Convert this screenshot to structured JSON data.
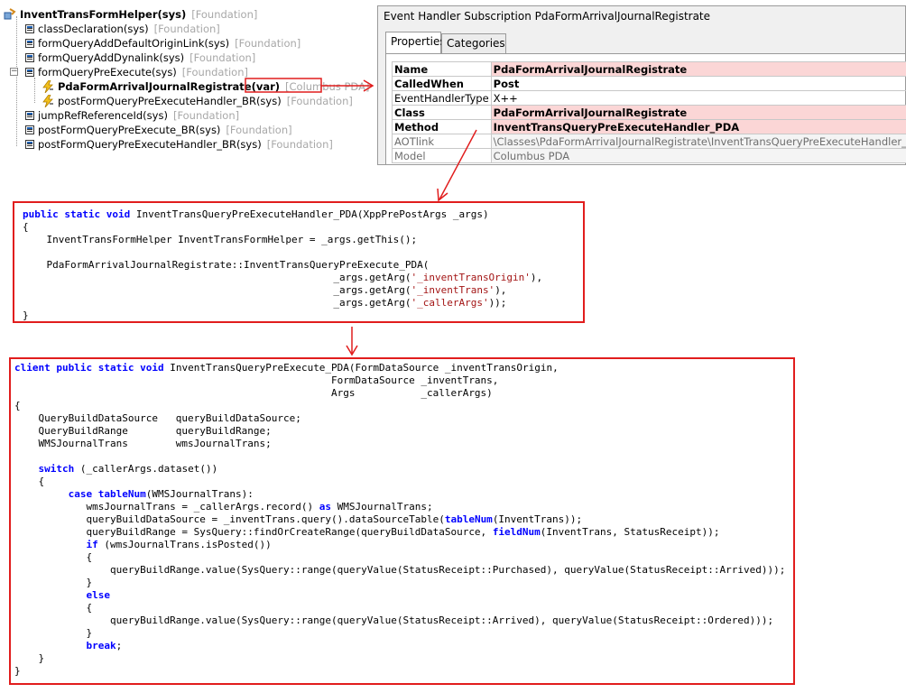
{
  "tree": {
    "root": {
      "name": "InventTransFormHelper(sys)",
      "layer": "[Foundation]"
    },
    "items": [
      {
        "name": "classDeclaration(sys)",
        "layer": "[Foundation]"
      },
      {
        "name": "formQueryAddDefaultOriginLink(sys)",
        "layer": "[Foundation]"
      },
      {
        "name": "formQueryAddDynalink(sys)",
        "layer": "[Foundation]"
      },
      {
        "name": "formQueryPreExecute(sys)",
        "layer": "[Foundation]",
        "expander": "−"
      },
      {
        "name": "PdaFormArrivalJournalRegistrate(var)",
        "layer": "[Columbus PDA]"
      },
      {
        "name": "postFormQueryPreExecuteHandler_BR(sys)",
        "layer": "[Foundation]"
      },
      {
        "name": "jumpRefReferenceId(sys)",
        "layer": "[Foundation]"
      },
      {
        "name": "postFormQueryPreExecute_BR(sys)",
        "layer": "[Foundation]"
      },
      {
        "name": "postFormQueryPreExecuteHandler_BR(sys)",
        "layer": "[Foundation]"
      }
    ]
  },
  "properties": {
    "title": "Event Handler Subscription PdaFormArrivalJournalRegistrate",
    "tabs": [
      "Properties",
      "Categories"
    ],
    "rows": [
      {
        "key": "Name",
        "value": "PdaFormArrivalJournalRegistrate"
      },
      {
        "key": "CalledWhen",
        "value": "Post"
      },
      {
        "key": "EventHandlerType",
        "value": "X++"
      },
      {
        "key": "Class",
        "value": "PdaFormArrivalJournalRegistrate"
      },
      {
        "key": "Method",
        "value": "InventTransQueryPreExecuteHandler_PDA"
      },
      {
        "key": "AOTlink",
        "value": "\\Classes\\PdaFormArrivalJournalRegistrate\\InventTransQueryPreExecuteHandler_PDA"
      },
      {
        "key": "Model",
        "value": "Columbus PDA"
      }
    ]
  },
  "code1": [
    [
      {
        "t": "kw",
        "v": "public"
      },
      {
        "v": " "
      },
      {
        "t": "kw",
        "v": "static"
      },
      {
        "v": " "
      },
      {
        "t": "kw",
        "v": "void"
      },
      {
        "v": " InventTransQueryPreExecuteHandler_PDA(XppPrePostArgs _args)"
      }
    ],
    [
      {
        "v": "{"
      }
    ],
    [
      {
        "v": "    InventTransFormHelper InventTransFormHelper = _args.getThis();"
      }
    ],
    [
      {
        "v": ""
      }
    ],
    [
      {
        "v": "    PdaFormArrivalJournalRegistrate::InventTransQueryPreExecute_PDA("
      }
    ],
    [
      {
        "v": "                                                    _args.getArg("
      },
      {
        "t": "str",
        "v": "'_inventTransOrigin'"
      },
      {
        "v": "),"
      }
    ],
    [
      {
        "v": "                                                    _args.getArg("
      },
      {
        "t": "str",
        "v": "'_inventTrans'"
      },
      {
        "v": "),"
      }
    ],
    [
      {
        "v": "                                                    _args.getArg("
      },
      {
        "t": "str",
        "v": "'_callerArgs'"
      },
      {
        "v": "));"
      }
    ],
    [
      {
        "v": "}"
      }
    ]
  ],
  "code2": [
    [
      {
        "t": "kw",
        "v": "client"
      },
      {
        "v": " "
      },
      {
        "t": "kw",
        "v": "public"
      },
      {
        "v": " "
      },
      {
        "t": "kw",
        "v": "static"
      },
      {
        "v": " "
      },
      {
        "t": "kw",
        "v": "void"
      },
      {
        "v": " InventTransQueryPreExecute_PDA(FormDataSource _inventTransOrigin,"
      }
    ],
    [
      {
        "v": "                                                     FormDataSource _inventTrans,"
      }
    ],
    [
      {
        "v": "                                                     Args           _callerArgs)"
      }
    ],
    [
      {
        "v": "{"
      }
    ],
    [
      {
        "v": "    QueryBuildDataSource   queryBuildDataSource;"
      }
    ],
    [
      {
        "v": "    QueryBuildRange        queryBuildRange;"
      }
    ],
    [
      {
        "v": "    WMSJournalTrans        wmsJournalTrans;"
      }
    ],
    [
      {
        "v": ""
      }
    ],
    [
      {
        "v": "    "
      },
      {
        "t": "kw",
        "v": "switch"
      },
      {
        "v": " (_callerArgs.dataset())"
      }
    ],
    [
      {
        "v": "    {"
      }
    ],
    [
      {
        "v": "         "
      },
      {
        "t": "kw",
        "v": "case"
      },
      {
        "v": " "
      },
      {
        "t": "kw",
        "v": "tableNum"
      },
      {
        "v": "(WMSJournalTrans):"
      }
    ],
    [
      {
        "v": "            wmsJournalTrans = _callerArgs.record() "
      },
      {
        "t": "kw",
        "v": "as"
      },
      {
        "v": " WMSJournalTrans;"
      }
    ],
    [
      {
        "v": "            queryBuildDataSource = _inventTrans.query().dataSourceTable("
      },
      {
        "t": "kw",
        "v": "tableNum"
      },
      {
        "v": "(InventTrans));"
      }
    ],
    [
      {
        "v": "            queryBuildRange = SysQuery::findOrCreateRange(queryBuildDataSource, "
      },
      {
        "t": "kw",
        "v": "fieldNum"
      },
      {
        "v": "(InventTrans, StatusReceipt));"
      }
    ],
    [
      {
        "v": "            "
      },
      {
        "t": "kw",
        "v": "if"
      },
      {
        "v": " (wmsJournalTrans.isPosted())"
      }
    ],
    [
      {
        "v": "            {"
      }
    ],
    [
      {
        "v": "                queryBuildRange.value(SysQuery::range(queryValue(StatusReceipt::Purchased), queryValue(StatusReceipt::Arrived)));"
      }
    ],
    [
      {
        "v": "            }"
      }
    ],
    [
      {
        "v": "            "
      },
      {
        "t": "kw",
        "v": "else"
      }
    ],
    [
      {
        "v": "            {"
      }
    ],
    [
      {
        "v": "                queryBuildRange.value(SysQuery::range(queryValue(StatusReceipt::Arrived), queryValue(StatusReceipt::Ordered)));"
      }
    ],
    [
      {
        "v": "            }"
      }
    ],
    [
      {
        "v": "            "
      },
      {
        "t": "kw",
        "v": "break"
      },
      {
        "v": ";"
      }
    ],
    [
      {
        "v": "    }"
      }
    ],
    [
      {
        "v": "}"
      }
    ]
  ],
  "colors": {
    "annotation": "#e11d1d",
    "keyword": "#0000ff",
    "string": "#a31515",
    "highlight_row": "#fbd6d6"
  },
  "icons": {
    "root": "class-icon",
    "method": "method-icon",
    "handler": "event-handler-icon"
  }
}
